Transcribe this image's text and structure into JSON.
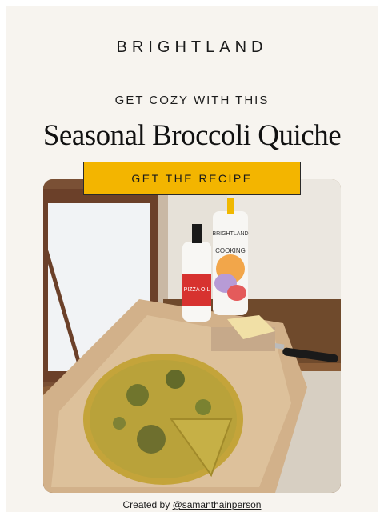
{
  "brand": {
    "name": "BRIGHTLAND"
  },
  "hero": {
    "kicker": "GET COZY WITH THIS",
    "title": "Seasonal Broccoli Quiche",
    "cta_label": "GET THE RECIPE"
  },
  "photo": {
    "bottle_brand": "BRIGHTLAND",
    "bottle_product": "COOKING",
    "small_bottle_label": "PIZZA OIL"
  },
  "credit": {
    "prefix": "Created by",
    "handle": "@samanthainperson"
  }
}
